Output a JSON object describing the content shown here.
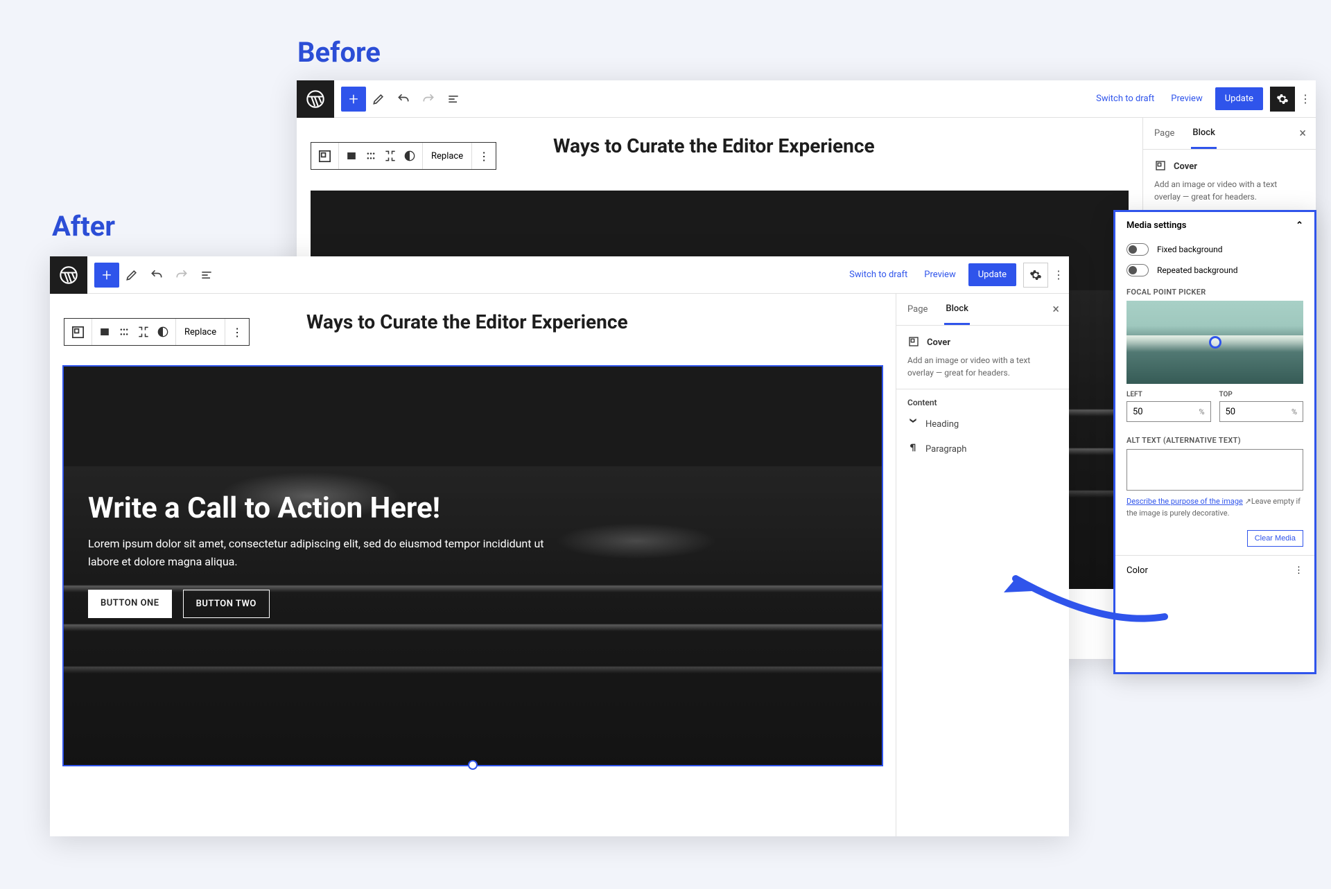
{
  "labels": {
    "before": "Before",
    "after": "After"
  },
  "topbar": {
    "switch_to_draft": "Switch to draft",
    "preview": "Preview",
    "update": "Update"
  },
  "block_toolbar": {
    "replace": "Replace"
  },
  "page": {
    "title": "Ways to Curate the Editor Experience"
  },
  "cover": {
    "heading": "Write a Call to Action Here!",
    "paragraph": "Lorem ipsum dolor sit amet, consectetur adipiscing elit, sed do eiusmod tempor incididunt ut labore et dolore magna aliqua.",
    "button_one": "BUTTON ONE",
    "button_two": "BUTTON TWO"
  },
  "sidebar": {
    "tab_page": "Page",
    "tab_block": "Block",
    "block_name": "Cover",
    "block_desc": "Add an image or video with a text overlay — great for headers.",
    "content_heading": "Content",
    "items": [
      {
        "label": "Heading"
      },
      {
        "label": "Paragraph"
      }
    ]
  },
  "media_panel": {
    "title": "Media settings",
    "fixed_bg": "Fixed background",
    "repeated_bg": "Repeated background",
    "focal_label": "FOCAL POINT PICKER",
    "left_label": "LEFT",
    "top_label": "TOP",
    "left_value": "50",
    "top_value": "50",
    "pct": "%",
    "alt_label": "ALT TEXT (ALTERNATIVE TEXT)",
    "link_text": "Describe the purpose of the image",
    "hint_tail": "Leave empty if the image is purely decorative.",
    "clear_media": "Clear Media",
    "color": "Color"
  }
}
